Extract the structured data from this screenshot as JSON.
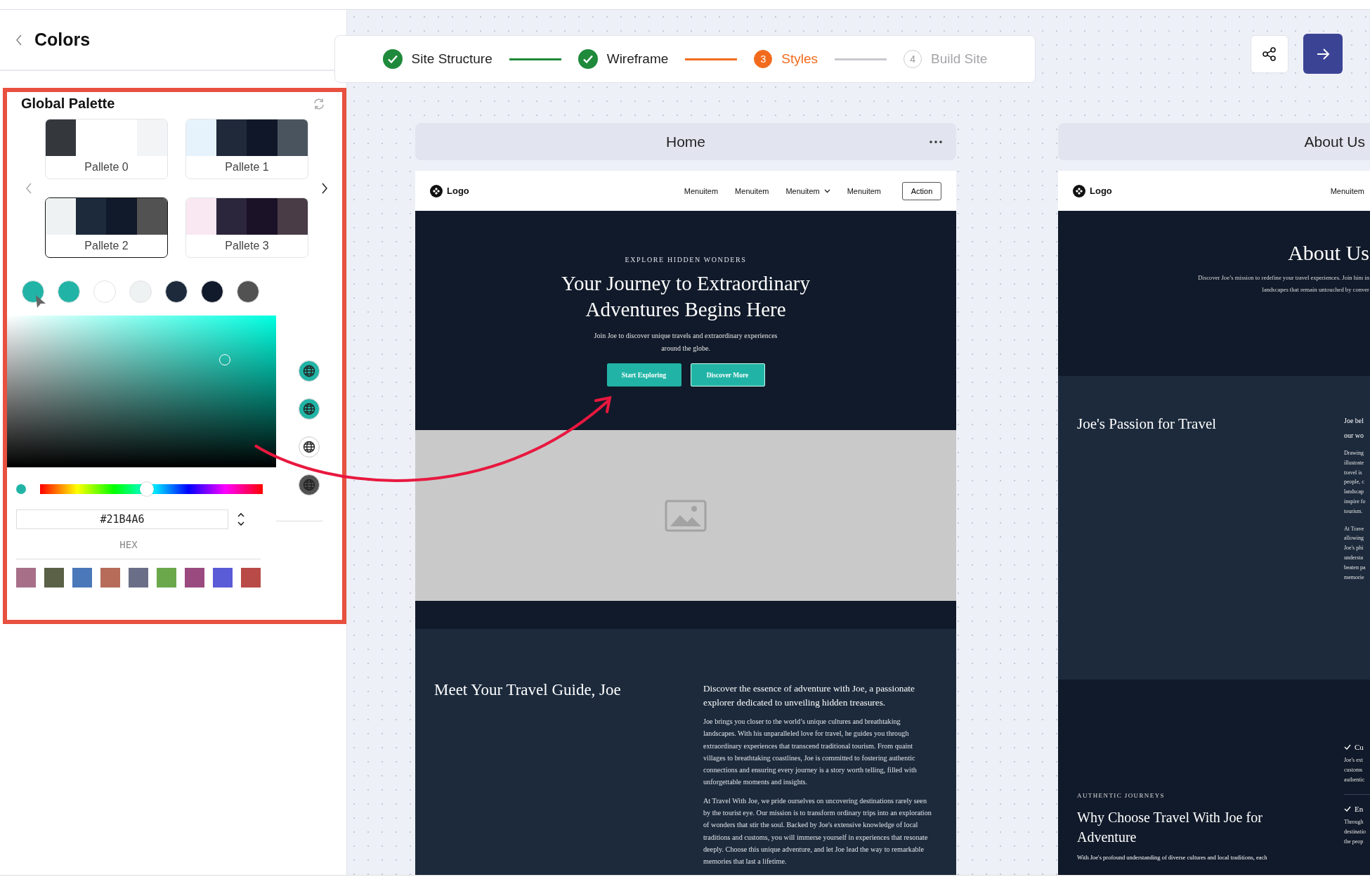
{
  "sidebar": {
    "title": "Colors"
  },
  "global_palette": {
    "title": "Global Palette",
    "palettes": [
      {
        "label": "Pallete 0",
        "selected": false,
        "colors": [
          {
            "color": "#34383d"
          },
          {
            "color": "#ffffff"
          },
          {
            "color": "#ffffff"
          },
          {
            "color": "#f3f4f5"
          }
        ]
      },
      {
        "label": "Pallete 1",
        "selected": false,
        "colors": [
          {
            "color": "#e6f3fc"
          },
          {
            "color": "#20293a"
          },
          {
            "color": "#101729"
          },
          {
            "color": "#4a545f"
          }
        ]
      },
      {
        "label": "Pallete 2",
        "selected": true,
        "colors": [
          {
            "color": "#eef2f2"
          },
          {
            "color": "#1c2a3c"
          },
          {
            "color": "#111a2a"
          },
          {
            "color": "#525252"
          }
        ]
      },
      {
        "label": "Pallete 3",
        "selected": false,
        "colors": [
          {
            "color": "#f9e8f1"
          },
          {
            "color": "#2c263c"
          },
          {
            "color": "#1b1228"
          },
          {
            "color": "#4a3c46"
          }
        ]
      }
    ],
    "swatches": [
      {
        "color": "#21b4a6"
      },
      {
        "color": "#21b4a6"
      },
      {
        "color": "#ffffff"
      },
      {
        "color": "#eef2f2"
      },
      {
        "color": "#1c2a3c"
      },
      {
        "color": "#111a2a"
      },
      {
        "color": "#525252"
      }
    ],
    "globe_buttons": [
      {
        "color": "#21b4a6"
      },
      {
        "color": "#21b4a6"
      },
      {
        "color": "#ffffff"
      },
      {
        "color": "#525252"
      }
    ]
  },
  "color_picker": {
    "hue_slider": {
      "level": 0.48
    },
    "current_color": {
      "color": "#21b4a6"
    },
    "hex": {
      "value": "#21B4A6",
      "label": "HEX"
    },
    "presets": [
      {
        "color": "#a86f88"
      },
      {
        "color": "#5a6146"
      },
      {
        "color": "#4a78b8"
      },
      {
        "color": "#b66c58"
      },
      {
        "color": "#6b6e87"
      },
      {
        "color": "#6aa84b"
      },
      {
        "color": "#9b4a80"
      },
      {
        "color": "#5a5bd6"
      },
      {
        "color": "#b84a47"
      }
    ]
  },
  "stepper": [
    {
      "label": "Site Structure",
      "kind": "done"
    },
    {
      "label": "Wireframe",
      "kind": "done"
    },
    {
      "label": "Styles",
      "kind": "active",
      "number": "3"
    },
    {
      "label": "Build Site",
      "kind": "todo",
      "number": "4"
    }
  ],
  "home_page": {
    "title": "Home",
    "nav": {
      "logo": "Logo",
      "menu_items": [
        {
          "label": "Menuitem",
          "dropdown": false
        },
        {
          "label": "Menuitem",
          "dropdown": false
        },
        {
          "label": "Menuitem",
          "dropdown": true
        },
        {
          "label": "Menuitem",
          "dropdown": false
        }
      ],
      "action": "Action"
    },
    "hero": {
      "eyebrow": "EXPLORE HIDDEN WONDERS",
      "title": "Your Journey to Extraordinary Adventures Begins Here",
      "subtitle": "Join Joe to discover unique travels and extraordinary experiences around the globe.",
      "buttons": [
        "Start Exploring",
        "Discover More"
      ]
    },
    "intro": {
      "heading": "Meet Your Travel Guide, Joe",
      "lead": "Discover the essence of adventure with Joe, a passionate explorer dedicated to unveiling hidden treasures.",
      "paragraphs": [
        "Joe brings you closer to the world’s unique cultures and breathtaking landscapes. With his unparalleled love for travel, he guides you through extraordinary experiences that transcend traditional tourism. From quaint villages to breathtaking coastlines, Joe is committed to fostering authentic connections and ensuring every journey is a story worth telling, filled with unforgettable moments and insights.",
        "At Travel With Joe, we pride ourselves on uncovering destinations rarely seen by the tourist eye. Our mission is to transform ordinary trips into an exploration of wonders that stir the soul. Backed by Joe's extensive knowledge of local traditions and customs, you will immerse yourself in experiences that resonate deeply. Choose this unique adventure, and let Joe lead the way to remarkable memories that last a lifetime."
      ]
    }
  },
  "about_page": {
    "title": "About Us",
    "nav": {
      "logo": "Logo",
      "menu_items": [
        "Menuitem"
      ]
    },
    "hero": {
      "title": "About Us",
      "lines": [
        "Discover Joe’s mission to redefine your travel experiences. Join him in",
        "landscapes that remain untouched by conver"
      ]
    },
    "passion": {
      "heading": "Joe's Passion for Travel",
      "lead_lines": [
        "Joe bel",
        "our wo"
      ],
      "paragraphs": [
        [
          "Drawing",
          "illustrate",
          "travel is",
          "people, c",
          "landscap",
          "inspire fo",
          "tourism."
        ],
        [
          "At Trave",
          "allowing",
          "Joe's phi",
          "understa",
          "beaten pa",
          "memorie"
        ]
      ]
    },
    "why": {
      "eyebrow": "AUTHENTIC JOURNEYS",
      "heading": "Why Choose Travel With Joe for Adventure",
      "text": "With Joe's profound understanding of diverse cultures and local traditions, each",
      "features": [
        {
          "title": "Cu",
          "lines": [
            "Joe's ext",
            "customs",
            "authentic"
          ]
        },
        {
          "title": "En",
          "lines": [
            "Through",
            "destinatio",
            "the peop"
          ]
        }
      ]
    }
  }
}
